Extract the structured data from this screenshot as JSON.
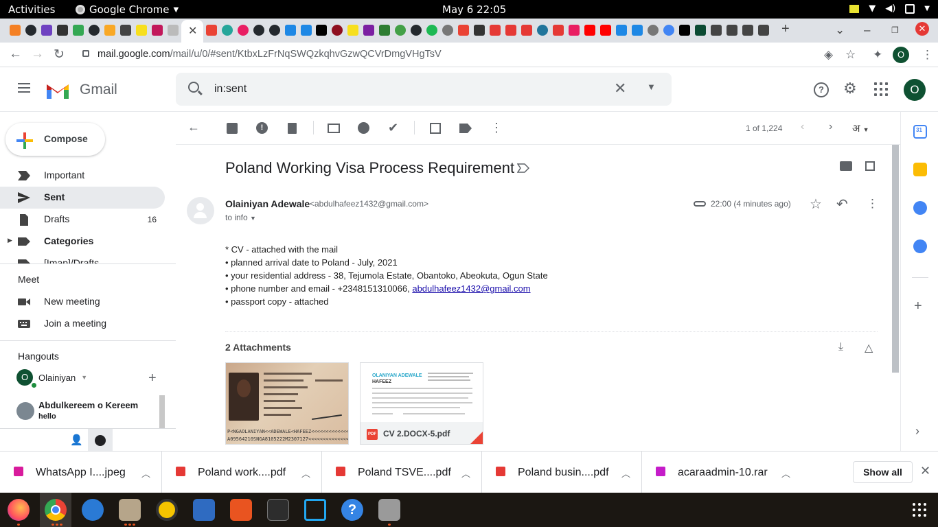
{
  "os": {
    "activities": "Activities",
    "app_name": "Google Chrome",
    "clock": "May 6  22:05"
  },
  "browser": {
    "url_domain": "mail.google.com",
    "url_path": "/mail/u/0/#sent/KtbxLzFrNqSWQzkqhvGzwQCVrDmgVHgTsV",
    "profile_initial": "O"
  },
  "gmail": {
    "logo_text": "Gmail",
    "search_value": "in:sent",
    "avatar_initial": "O",
    "compose_label": "Compose",
    "nav": [
      {
        "label": "Important",
        "count": ""
      },
      {
        "label": "Sent",
        "count": ""
      },
      {
        "label": "Drafts",
        "count": "16"
      },
      {
        "label": "Categories",
        "count": ""
      },
      {
        "label": "[Imap]/Drafts",
        "count": ""
      }
    ],
    "meet": {
      "title": "Meet",
      "new_meeting": "New meeting",
      "join_meeting": "Join a meeting"
    },
    "hangouts": {
      "title": "Hangouts",
      "user_initial": "O",
      "user_name": "Olainiyan",
      "chat_name": "Abdulkereem o Kereem",
      "chat_preview": "hello"
    },
    "pager": "1 of 1,224",
    "lang_label": "अ"
  },
  "message": {
    "subject": "Poland Working Visa Process Requirement",
    "sender_name": "Olainiyan Adewale",
    "sender_email": "<abdulhafeez1432@gmail.com>",
    "to": "to info",
    "time": "22:00 (4 minutes ago)",
    "body": [
      "* CV - attached with the mail",
      "• planned arrival date to Poland - July, 2021",
      "• your residential address - 38, Tejumola Estate, Obantoko, Abeokuta, Ogun State",
      "• phone number and email - +2348151310066, "
    ],
    "body_link": "abdulhafeez1432@gmail.com",
    "body_last": "• passport copy - attached",
    "attachments_title": "2 Attachments",
    "attachment_file": "CV 2.DOCX-5.pdf",
    "passport_mrz": "P<NGAOLANIYAN<<ADEWALE<HAFEEZ<<<<<<<<<<<<<<<",
    "passport_mrz2": "A09564210SNGA8105222M2307127<<<<<<<<<<<<<<",
    "cv_name": "OLANIYAN ADEWALE",
    "cv_name2": "HAFEEZ"
  },
  "downloads": {
    "items": [
      {
        "name": "WhatsApp I....jpeg",
        "color": "#d81b9c"
      },
      {
        "name": "Poland work....pdf",
        "color": "#e53935"
      },
      {
        "name": "Poland TSVE....pdf",
        "color": "#e53935"
      },
      {
        "name": "Poland busin....pdf",
        "color": "#e53935"
      },
      {
        "name": "acaraadmin-10.rar",
        "color": "#c51cc9"
      }
    ],
    "show_all": "Show all"
  },
  "colors": {
    "gmail_red": "#ea4335",
    "accent_blue": "#1a73e8",
    "avatar_green": "#0f5132"
  }
}
